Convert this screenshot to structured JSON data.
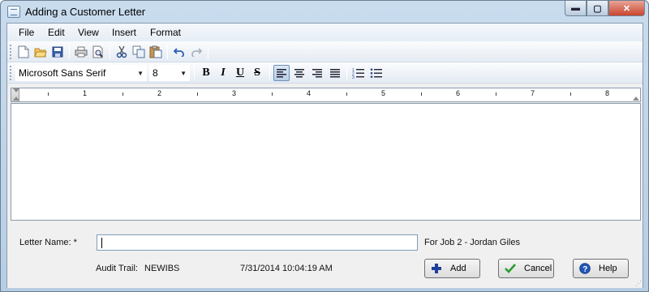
{
  "window": {
    "title": "Adding a Customer Letter",
    "caption": {
      "minimize": "▬",
      "maximize": "▢",
      "close": "✕"
    }
  },
  "menu": [
    "File",
    "Edit",
    "View",
    "Insert",
    "Format"
  ],
  "toolbar": {
    "icons": [
      "new-document-icon",
      "open-folder-icon",
      "save-icon",
      "print-icon",
      "print-preview-icon",
      "cut-icon",
      "copy-icon",
      "paste-icon",
      "undo-icon",
      "redo-icon"
    ]
  },
  "format_bar": {
    "font_name": "Microsoft Sans Serif",
    "font_size": "8",
    "bold": "B",
    "italic": "I",
    "underline": "U",
    "strikethrough": "S",
    "active_alignment": "left"
  },
  "ruler": {
    "numbers": [
      "1",
      "2",
      "3",
      "4",
      "5",
      "6",
      "7",
      "8"
    ]
  },
  "form": {
    "letter_name_label": "Letter Name: *",
    "letter_name_value": "",
    "for_job": "For Job 2 - Jordan Giles",
    "audit_trail_label": "Audit Trail:",
    "audit_user": "NEWIBS",
    "audit_timestamp": "7/31/2014 10:04:19 AM"
  },
  "buttons": {
    "add": "Add",
    "cancel": "Cancel",
    "help": "Help"
  },
  "colors": {
    "add_icon": "#1f3f9a",
    "cancel_icon": "#2e9a2e",
    "help_icon": "#1f4fb0"
  }
}
